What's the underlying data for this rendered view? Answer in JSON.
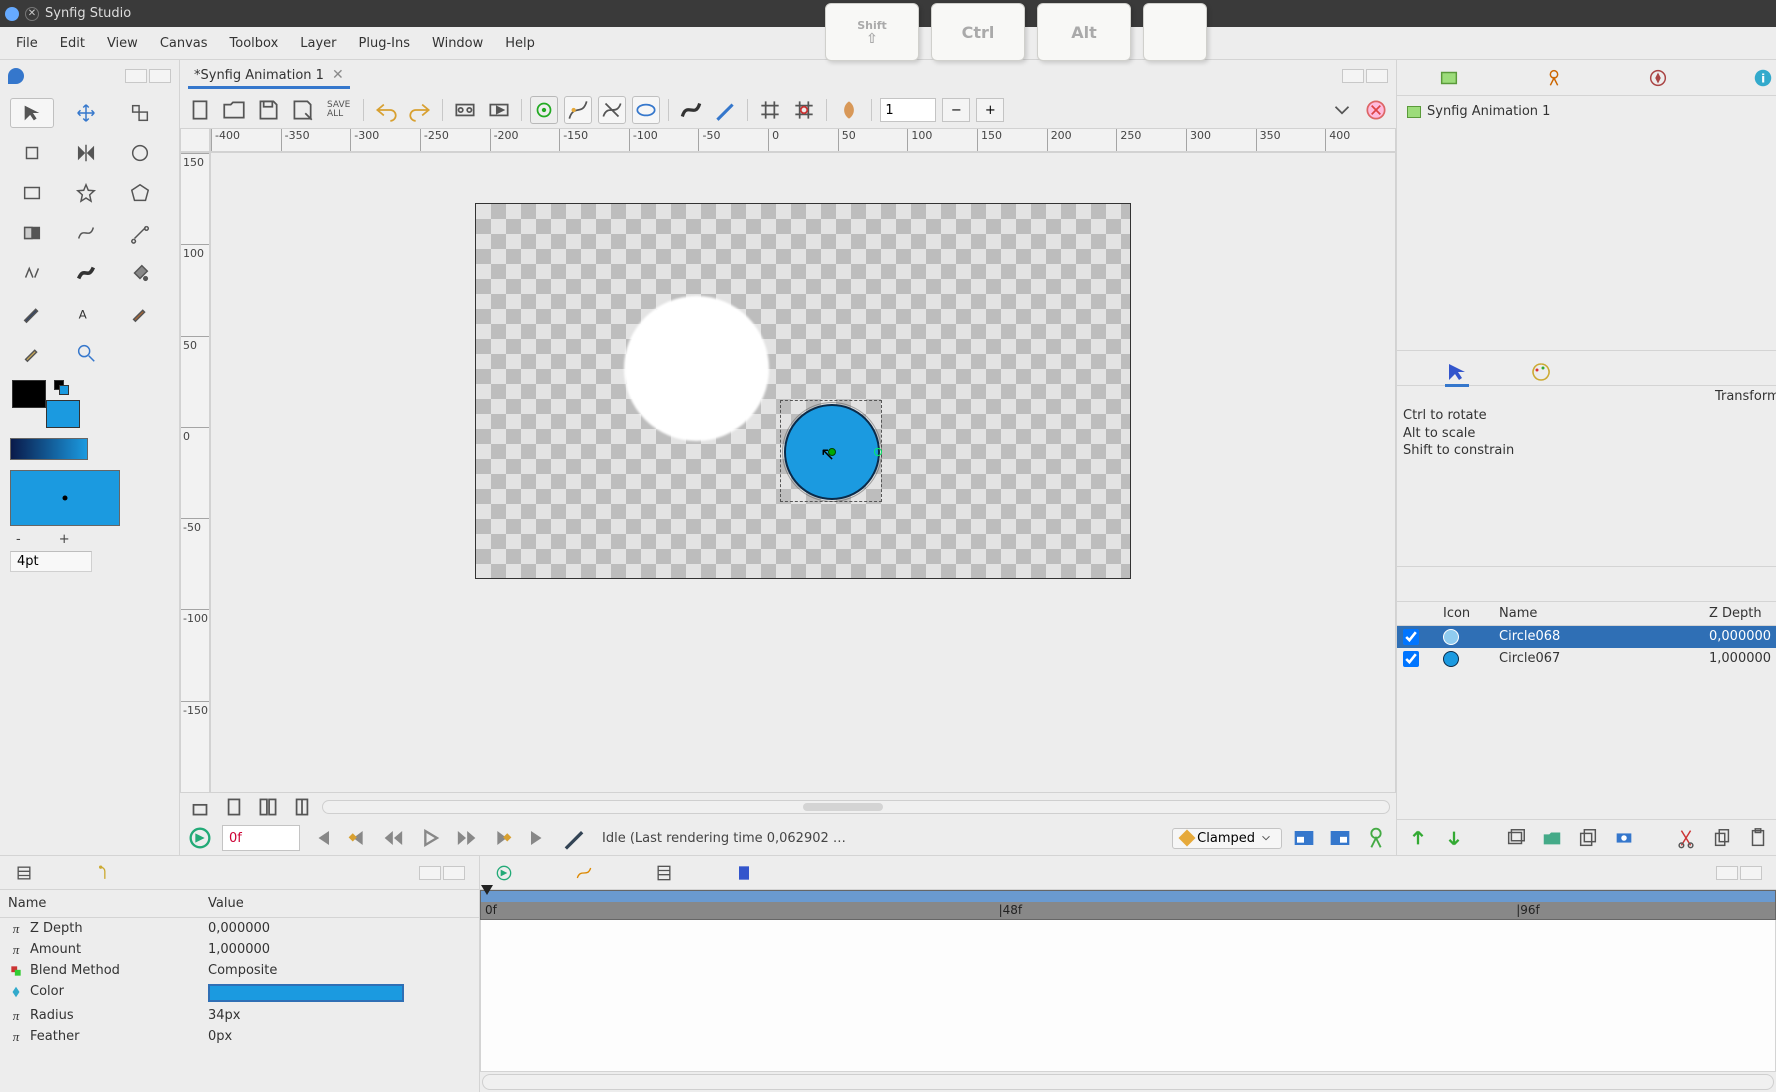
{
  "app": {
    "title": "Synfig Studio"
  },
  "menu": {
    "file": "File",
    "edit": "Edit",
    "view": "View",
    "canvas": "Canvas",
    "toolbox": "Toolbox",
    "layer": "Layer",
    "plugins": "Plug-Ins",
    "window": "Window",
    "help": "Help"
  },
  "keys": {
    "shift": "Shift",
    "ctrl": "Ctrl",
    "alt": "Alt"
  },
  "doc": {
    "tab": "*Synfig Animation 1"
  },
  "toolbar": {
    "save_all": "SAVE\nALL",
    "zoom": "1",
    "minus": "−",
    "plus": "+"
  },
  "brush": {
    "size_label": "4pt",
    "minus": "-",
    "plus": "+"
  },
  "ruler_h": [
    "-400",
    "-350",
    "-300",
    "-250",
    "-200",
    "-150",
    "-100",
    "-50",
    "0",
    "50",
    "100",
    "150",
    "200",
    "250",
    "300",
    "350",
    "400"
  ],
  "ruler_v": [
    "150",
    "100",
    "50",
    "0",
    "-50",
    "-100",
    "-150"
  ],
  "playbar": {
    "time": "0f",
    "status": "Idle (Last rendering time 0,062902 …",
    "interp": "Clamped"
  },
  "canvas_list": {
    "item0": "Synfig Animation 1"
  },
  "tool_help": {
    "title": "Transform Tool",
    "l1": "Ctrl to rotate",
    "l2": "Alt to scale",
    "l3": "Shift to constrain"
  },
  "layers": {
    "h_icon": "Icon",
    "h_name": "Name",
    "h_z": "Z Depth",
    "r0_name": "Circle068",
    "r0_z": "0,000000",
    "r1_name": "Circle067",
    "r1_z": "1,000000"
  },
  "params": {
    "h_name": "Name",
    "h_value": "Value",
    "p0_n": "Z Depth",
    "p0_v": "0,000000",
    "p1_n": "Amount",
    "p1_v": "1,000000",
    "p2_n": "Blend Method",
    "p2_v": "Composite",
    "p3_n": "Color",
    "p4_n": "Radius",
    "p4_v": "34px",
    "p5_n": "Feather",
    "p5_v": "0px"
  },
  "timeline": {
    "t0": "0f",
    "t1": "|48f",
    "t2": "|96f"
  }
}
